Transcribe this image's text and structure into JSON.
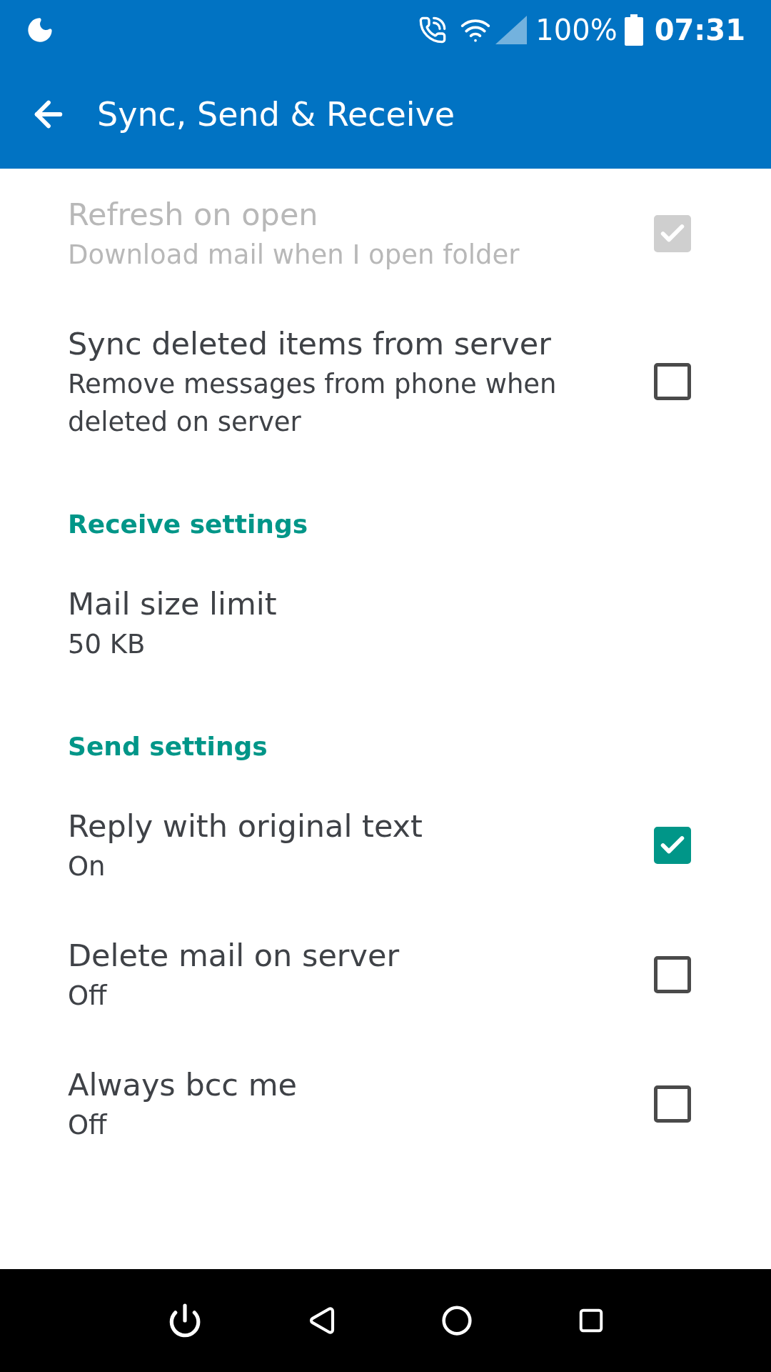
{
  "status_bar": {
    "battery": "100%",
    "time": "07:31"
  },
  "toolbar": {
    "title": "Sync, Send & Receive"
  },
  "settings": [
    {
      "kind": "checkbox",
      "title": "Refresh on open",
      "summary": "Download mail when I open folder",
      "checked": true,
      "disabled": true
    },
    {
      "kind": "checkbox",
      "title": "Sync deleted items from server",
      "summary": "Remove messages from phone when deleted on server",
      "checked": false,
      "disabled": false
    },
    {
      "kind": "header",
      "title": "Receive settings"
    },
    {
      "kind": "value",
      "title": "Mail size limit",
      "summary": "50 KB"
    },
    {
      "kind": "header",
      "title": "Send settings"
    },
    {
      "kind": "checkbox",
      "title": "Reply with original text",
      "summary": "On",
      "checked": true,
      "disabled": false
    },
    {
      "kind": "checkbox",
      "title": "Delete mail on server",
      "summary": "Off",
      "checked": false,
      "disabled": false
    },
    {
      "kind": "checkbox",
      "title": "Always bcc me",
      "summary": "Off",
      "checked": false,
      "disabled": false
    }
  ]
}
